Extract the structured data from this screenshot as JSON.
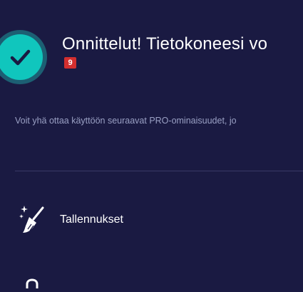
{
  "header": {
    "title": "Onnittelut! Tietokoneesi vo",
    "notification_count": "9"
  },
  "main": {
    "subtext": "Voit yhä ottaa käyttöön seuraavat PRO-ominaisuudet, jo",
    "features": [
      {
        "label": "Tallennukset",
        "icon": "broom-sparkle-icon"
      }
    ]
  },
  "colors": {
    "background": "#1a1a42",
    "accent": "#10c6bd",
    "badge": "#d32f2f"
  }
}
